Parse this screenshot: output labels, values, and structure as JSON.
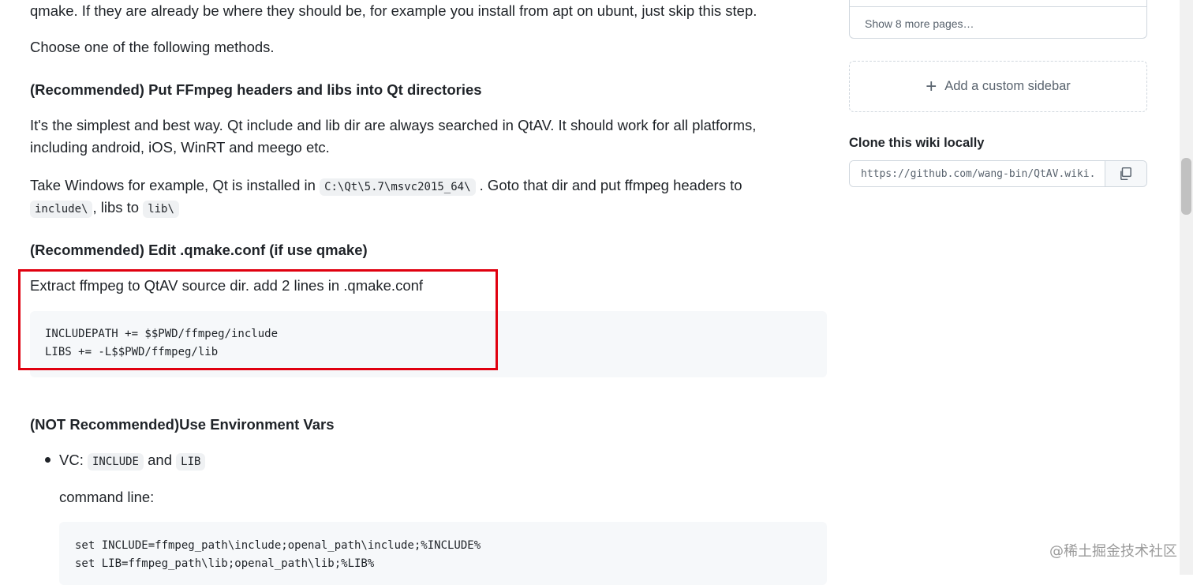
{
  "content": {
    "intro_tail": "qmake. If they are already be where they should be, for example you install from apt on ubunt, just skip this step.",
    "choose": "Choose one of the following methods.",
    "h1": "(Recommended) Put FFmpeg headers and libs into Qt directories",
    "p1_line1": "It's the simplest and best way. Qt include and lib dir are always searched in QtAV. It should work for all platforms,",
    "p1_line2": "including android, iOS, WinRT and meego etc.",
    "p2_a": "Take Windows for example, Qt is installed in",
    "p2_code1": "C:\\Qt\\5.7\\msvc2015_64\\",
    "p2_b": ". Goto that dir and put ffmpeg headers to",
    "p2_code2": "include\\",
    "p2_c": ", libs to",
    "p2_code3": "lib\\",
    "h2": "(Recommended) Edit .qmake.conf (if use qmake)",
    "p3": "Extract ffmpeg to QtAV source dir. add 2 lines in .qmake.conf",
    "code1": [
      "INCLUDEPATH += $$PWD/ffmpeg/include",
      "LIBS += -L$$PWD/ffmpeg/lib"
    ],
    "h3": "(NOT Recommended)Use Environment Vars",
    "li_vc_a": "VC:",
    "li_vc_code1": "INCLUDE",
    "li_vc_and": "and",
    "li_vc_code2": "LIB",
    "cmdline": "command line:",
    "code2": [
      "set INCLUDE=ffmpeg_path\\include;openal_path\\include;%INCLUDE%",
      "set LIB=ffmpeg_path\\lib;openal_path\\lib;%LIB%"
    ]
  },
  "sidebar": {
    "show_more": "Show 8 more pages…",
    "add_custom": "Add a custom sidebar",
    "clone_title": "Clone this wiki locally",
    "clone_url": "https://github.com/wang-bin/QtAV.wiki.git"
  },
  "watermark": "@稀土掘金技术社区",
  "colors": {
    "highlight": "#e0000f",
    "text": "#1f2328",
    "muted": "#59636e",
    "code_bg": "#f6f8fa"
  },
  "icons": {
    "add": "plus-icon",
    "copy": "copy-icon"
  }
}
